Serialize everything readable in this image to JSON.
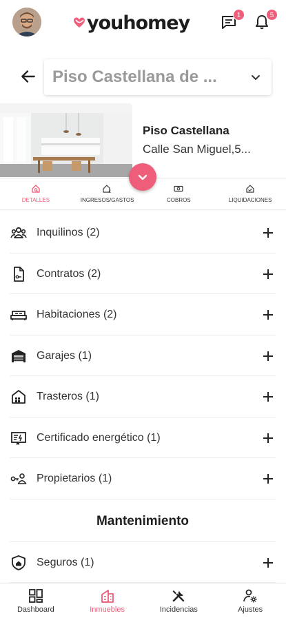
{
  "header": {
    "logo_text": "youhomey",
    "messages_badge": "1",
    "notifications_badge": "5"
  },
  "property": {
    "selector_text": "Piso Castellana de ...",
    "name": "Piso Castellana",
    "address": "Calle San Miguel,5..."
  },
  "tabs": [
    {
      "label": "DETALLES",
      "active": true
    },
    {
      "label": "INGRESOS/GASTOS",
      "active": false
    },
    {
      "label": "COBROS",
      "active": false
    },
    {
      "label": "LIQUIDACIONES",
      "active": false
    }
  ],
  "sections": {
    "inquilinos": "Inquilinos (2)",
    "contratos": "Contratos (2)",
    "habitaciones": "Habitaciones (2)",
    "garajes": "Garajes (1)",
    "trasteros": "Trasteros (1)",
    "certificado": "Certificado energético (1)",
    "propietarios": "Propietarios (1)",
    "mantenimiento_title": "Mantenimiento",
    "seguros": "Seguros (1)"
  },
  "bottom_nav": {
    "dashboard": "Dashboard",
    "inmuebles": "Inmuebles",
    "incidencias": "Incidencias",
    "ajustes": "Ajustes",
    "active": "inmuebles"
  },
  "colors": {
    "accent": "#ee5d79",
    "text": "#333333",
    "selector_text": "#9a9a9a"
  }
}
